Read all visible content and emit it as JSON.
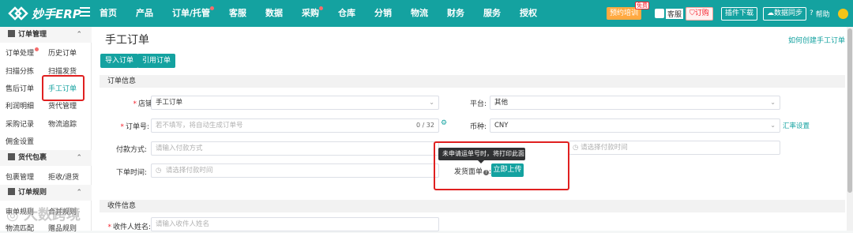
{
  "app": {
    "logo_text": "妙手ERP"
  },
  "nav": [
    {
      "label": "首页",
      "dot": false
    },
    {
      "label": "产品",
      "dot": false
    },
    {
      "label": "订单/托管",
      "dot": true
    },
    {
      "label": "客服",
      "dot": false
    },
    {
      "label": "数据",
      "dot": false
    },
    {
      "label": "采购",
      "dot": true
    },
    {
      "label": "仓库",
      "dot": false
    },
    {
      "label": "分销",
      "dot": false
    },
    {
      "label": "物流",
      "dot": false
    },
    {
      "label": "财务",
      "dot": false
    },
    {
      "label": "服务",
      "dot": false
    },
    {
      "label": "授权",
      "dot": false
    }
  ],
  "topright": {
    "appointment": "预约培训",
    "free_tag": "免费",
    "service": "客服",
    "order": "订购",
    "plugin_download": "插件下载",
    "data_sync": "数据同步",
    "help": "帮助"
  },
  "sidebar": {
    "order_mgmt": "订单管理",
    "order_processing": "订单处理",
    "history_orders": "历史订单",
    "scan_sort": "扫描分拣",
    "scan_ship": "扫描发货",
    "after_sales": "售后订单",
    "manual_order": "手工订单",
    "profit_detail": "利润明细",
    "agent_mgmt": "货代管理",
    "purchase_record": "采购记录",
    "logistics_track": "物流追踪",
    "commission_settings": "佣金设置",
    "agent_package": "货代包裹",
    "package_mgmt": "包裹管理",
    "reject_return": "拒收/退货",
    "order_rules": "订单规则",
    "audit_rules": "审单规则",
    "combo_rules": "合并规则",
    "logistics_match": "物流匹配",
    "gift_rules": "赠品规则"
  },
  "main": {
    "title": "手工订单",
    "help_link": "如何创建手工订单",
    "btn_import": "导入订单",
    "btn_quote": "引用订单",
    "section_order_info": "订单信息",
    "store_label": "店铺:",
    "store_value": "手工订单",
    "platform_label": "平台:",
    "platform_value": "其他",
    "order_no_label": "订单号:",
    "order_no_placeholder": "若不填写，将自动生成订单号",
    "order_no_counter": "0 / 32",
    "currency_label": "币种:",
    "currency_value": "CNY",
    "rate_settings": "汇率设置",
    "payment_method_label": "付款方式:",
    "payment_method_placeholder": "请输入付款方式",
    "payment_time_placeholder": "请选择付款时间",
    "order_time_label": "下单时间:",
    "order_time_placeholder": "请选择付款时间",
    "tooltip_text": "未申请运单号时，将打印此面单",
    "shipping_label_label": "发货面单",
    "upload_btn": "立即上传",
    "section_recipient": "收件信息",
    "recipient_name_label": "收件人姓名:",
    "recipient_name_placeholder": "请输入收件人姓名"
  },
  "watermark": "大数跨境",
  "colors": {
    "brand": "#14a2a0",
    "highlight": "#e02020"
  }
}
